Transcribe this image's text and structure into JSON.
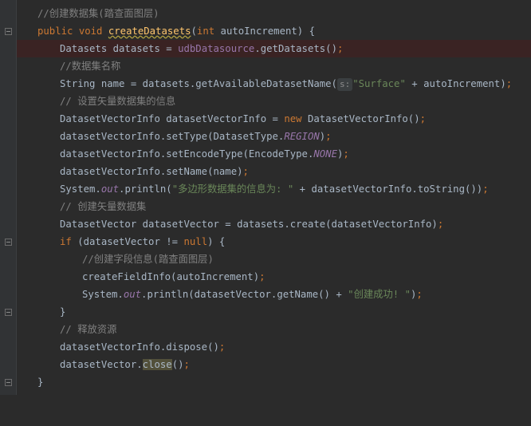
{
  "colors": {
    "background": "#2b2b2b",
    "gutter": "#313335",
    "keyword": "#cc7832",
    "method": "#ffc66d",
    "comment": "#808080",
    "string": "#6a8759",
    "field": "#9876aa",
    "text": "#a9b7c6",
    "highlight_line": "#3a2323"
  },
  "lines": [
    {
      "comment": "//创建数据集(踏查面图层)"
    },
    {
      "kw_public": "public",
      "kw_void": "void",
      "method": "createDatasets",
      "open": "(",
      "kw_int": "int",
      "rest": " autoIncrement) {"
    },
    {
      "pre": "Datasets datasets = ",
      "field": "udbDatasource",
      "post": ".getDatasets()",
      "semi": ";"
    },
    {
      "comment": "//数据集名称"
    },
    {
      "pre": "String name = datasets.getAvailableDatasetName(",
      "hint": "s:",
      "string": "\"Surface\"",
      "post": " + autoIncrement)",
      "semi": ";"
    },
    {
      "comment": "// 设置矢量数据集的信息"
    },
    {
      "pre": "DatasetVectorInfo datasetVectorInfo = ",
      "kw": "new",
      "post": " DatasetVectorInfo()",
      "semi": ";"
    },
    {
      "pre": "datasetVectorInfo.setType(DatasetType.",
      "const": "REGION",
      "post": ")",
      "semi": ";"
    },
    {
      "pre": "datasetVectorInfo.setEncodeType(EncodeType.",
      "const": "NONE",
      "post": ")",
      "semi": ";"
    },
    {
      "pre": "datasetVectorInfo.setName(name)",
      "semi": ";"
    },
    {
      "pre": "System.",
      "const": "out",
      "mid": ".println(",
      "string": "\"多边形数据集的信息为: \"",
      "post": " + datasetVectorInfo.toString())",
      "semi": ";"
    },
    {
      "comment": "// 创建矢量数据集"
    },
    {
      "pre": "DatasetVector datasetVector = datasets.create(datasetVectorInfo)",
      "semi": ";"
    },
    {
      "kw": "if",
      "pre": " (datasetVector != ",
      "kw_null": "null",
      "post": ") {"
    },
    {
      "comment": "//创建字段信息(踏查面图层)"
    },
    {
      "pre": "createFieldInfo(autoIncrement)",
      "semi": ";"
    },
    {
      "pre": "System.",
      "const": "out",
      "mid": ".println(datasetVector.getName() + ",
      "string": "\"创建成功! \"",
      "post": ")",
      "semi": ";"
    },
    {
      "pre": "}"
    },
    {
      "comment": "// 释放资源"
    },
    {
      "pre": "datasetVectorInfo.dispose()",
      "semi": ";"
    },
    {
      "pre": "datasetVector.",
      "word": "close",
      "post": "()",
      "semi": ";"
    },
    {
      "pre": "}"
    }
  ]
}
